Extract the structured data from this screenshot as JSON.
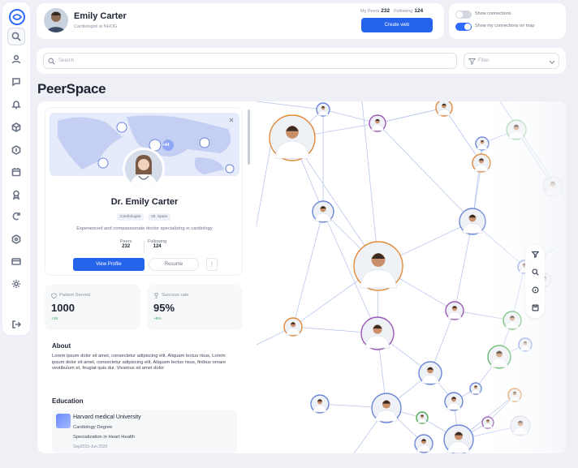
{
  "header": {
    "user_name": "Emily Carter",
    "user_role": "Cardiologist at NHOG",
    "peers_label": "My Peers",
    "peers_count": "232",
    "following_label": "Following",
    "following_count": "124",
    "create_button": "Create web"
  },
  "toggles": [
    {
      "label": "Show connections",
      "on": false
    },
    {
      "label": "Show my connections on map",
      "on": true
    }
  ],
  "search": {
    "placeholder": "Search"
  },
  "filter": {
    "placeholder": "Filter"
  },
  "page_title": "PeerSpace",
  "profile": {
    "map_badge": "+44",
    "name": "Dr. Emily Carter",
    "chips": [
      "Cardiologist",
      "25, Spain"
    ],
    "description": "Experienced and compassionate doctor specializing in cardiology",
    "peers_label": "Peers",
    "peers_value": "232",
    "following_label": "Following",
    "following_value": "124",
    "view_button": "View Profile",
    "resume_button": "Resume",
    "more_button": "⋮"
  },
  "stats": [
    {
      "label": "Patient Served",
      "value": "1000",
      "delta": "+10"
    },
    {
      "label": "Success rate",
      "value": "95%",
      "delta": "+5%"
    }
  ],
  "about": {
    "title": "About",
    "text": "Lorem ipsum dolor sit amet, consectetur adipiscing elit. Aliquam lectus risus, Lorem ipsum dolor sit amet, consectetur adipiscing elit. Aliquam lectus risus, finibus ornare vestibulum et, feugiat quis dui. Vivamus sit amet dolor"
  },
  "education": {
    "title": "Education",
    "school": "Harvard medical University",
    "degree": "Cardiology Degree",
    "specialization": "Specialization in Heart Health",
    "dates": "Sep2015-Jun 2020"
  },
  "sidebar_icons": [
    "search-icon",
    "user-icon",
    "chat-icon",
    "bell-icon",
    "box-icon",
    "briefcase-icon",
    "calendar-icon",
    "award-icon",
    "pen-icon",
    "settings-cog-icon",
    "card-icon",
    "gear-icon",
    "logout-icon"
  ],
  "colors": {
    "accent": "#2563eb",
    "success": "#22a55a"
  }
}
